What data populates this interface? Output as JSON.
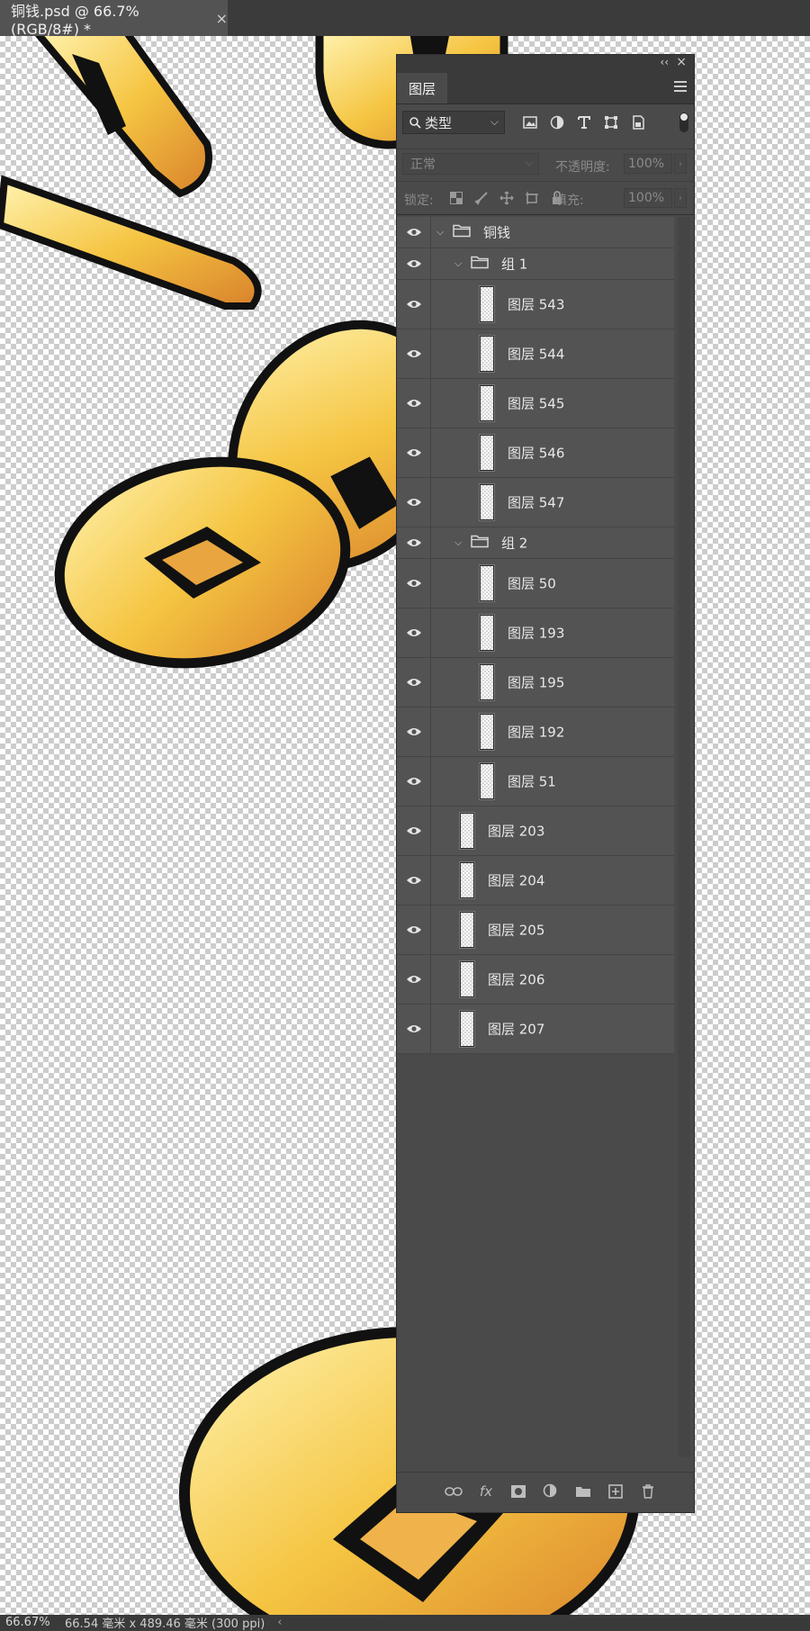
{
  "document_tab": {
    "title": "铜钱.psd @ 66.7%(RGB/8#) *",
    "close_glyph": "×"
  },
  "panel": {
    "collapse_glyph": "‹‹",
    "close_glyph": "×",
    "tab_label": "图层",
    "filter_kind": "类型",
    "filter_icons": [
      "image-filter-icon",
      "adjustment-filter-icon",
      "type-filter-icon",
      "shape-filter-icon",
      "smart-object-filter-icon"
    ],
    "blend_mode": "正常",
    "opacity_label": "不透明度:",
    "opacity_value": "100%",
    "lock_label": "锁定:",
    "lock_icons": [
      "lock-transparent-icon",
      "lock-image-icon",
      "lock-position-icon",
      "lock-artboard-icon",
      "lock-all-icon"
    ],
    "fill_label": "填充:",
    "fill_value": "100%",
    "bottom_icons": [
      "link-layers-icon",
      "fx-icon",
      "add-mask-icon",
      "adjustment-layer-icon",
      "new-group-icon",
      "new-layer-icon",
      "trash-icon"
    ],
    "bottom_fx_text": "fx"
  },
  "layers": [
    {
      "name": "铜钱",
      "type": "group",
      "level": 0
    },
    {
      "name": "组 1",
      "type": "group",
      "level": 1
    },
    {
      "name": "图层 543",
      "type": "layer",
      "level": 2
    },
    {
      "name": "图层 544",
      "type": "layer",
      "level": 2
    },
    {
      "name": "图层 545",
      "type": "layer",
      "level": 2
    },
    {
      "name": "图层 546",
      "type": "layer",
      "level": 2
    },
    {
      "name": "图层 547",
      "type": "layer",
      "level": 2
    },
    {
      "name": "组 2",
      "type": "group",
      "level": 1
    },
    {
      "name": "图层 50",
      "type": "layer",
      "level": 2
    },
    {
      "name": "图层 193",
      "type": "layer",
      "level": 2
    },
    {
      "name": "图层 195",
      "type": "layer",
      "level": 2
    },
    {
      "name": "图层 192",
      "type": "layer",
      "level": 2
    },
    {
      "name": "图层 51",
      "type": "layer",
      "level": 2
    },
    {
      "name": "图层 203",
      "type": "layer",
      "level": 1
    },
    {
      "name": "图层 204",
      "type": "layer",
      "level": 1
    },
    {
      "name": "图层 205",
      "type": "layer",
      "level": 1
    },
    {
      "name": "图层 206",
      "type": "layer",
      "level": 1
    },
    {
      "name": "图层 207",
      "type": "layer",
      "level": 1
    }
  ],
  "status": {
    "zoom": "66.67%",
    "doc_size": "66.54 毫米 x 489.46 毫米 (300 ppi)",
    "arrow": "‹"
  },
  "colors": {
    "coin_fill": "#f5c542",
    "coin_highlight": "#fff3b0",
    "coin_shadow": "#d9822b",
    "outline": "#111111"
  }
}
